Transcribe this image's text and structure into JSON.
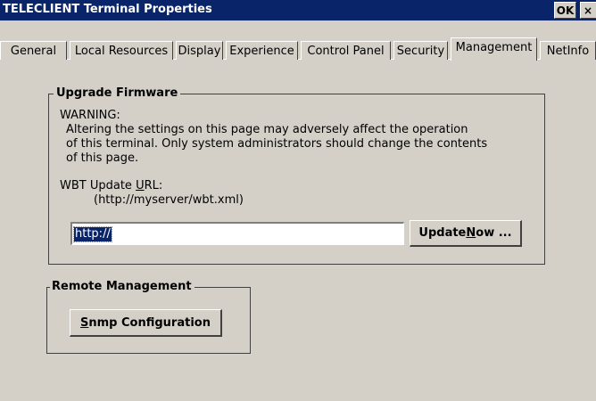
{
  "window": {
    "title": "TELECLIENT Terminal Properties",
    "ok_label": "OK",
    "close_label": "×"
  },
  "tabs": [
    {
      "label": "General",
      "active": false
    },
    {
      "label": "Local Resources",
      "active": false
    },
    {
      "label": "Display",
      "active": false
    },
    {
      "label": "Experience",
      "active": false
    },
    {
      "label": "Control Panel",
      "active": false
    },
    {
      "label": "Security",
      "active": false
    },
    {
      "label": "Management",
      "active": true
    },
    {
      "label": "NetInfo",
      "active": false
    }
  ],
  "upgrade_firmware": {
    "legend": "Upgrade Firmware",
    "warning_heading": "WARNING:",
    "warning_lines": [
      "Altering the settings on this page may adversely affect the operation",
      "of this terminal.  Only system administrators should change the contents",
      "of this page."
    ],
    "url_label_prefix": "WBT Update ",
    "url_label_mnemonic": "U",
    "url_label_suffix": "RL:",
    "url_example": "(http://myserver/wbt.xml)",
    "url_value": "http://",
    "update_label_prefix": "Update ",
    "update_label_mnemonic": "N",
    "update_label_suffix": "ow ..."
  },
  "remote_management": {
    "legend": "Remote Management",
    "snmp_mnemonic": "S",
    "snmp_label_suffix": "nmp Configuration"
  },
  "colors": {
    "title_bar": "#0a246a",
    "face": "#d4d0c8",
    "selection": "#0a246a"
  }
}
